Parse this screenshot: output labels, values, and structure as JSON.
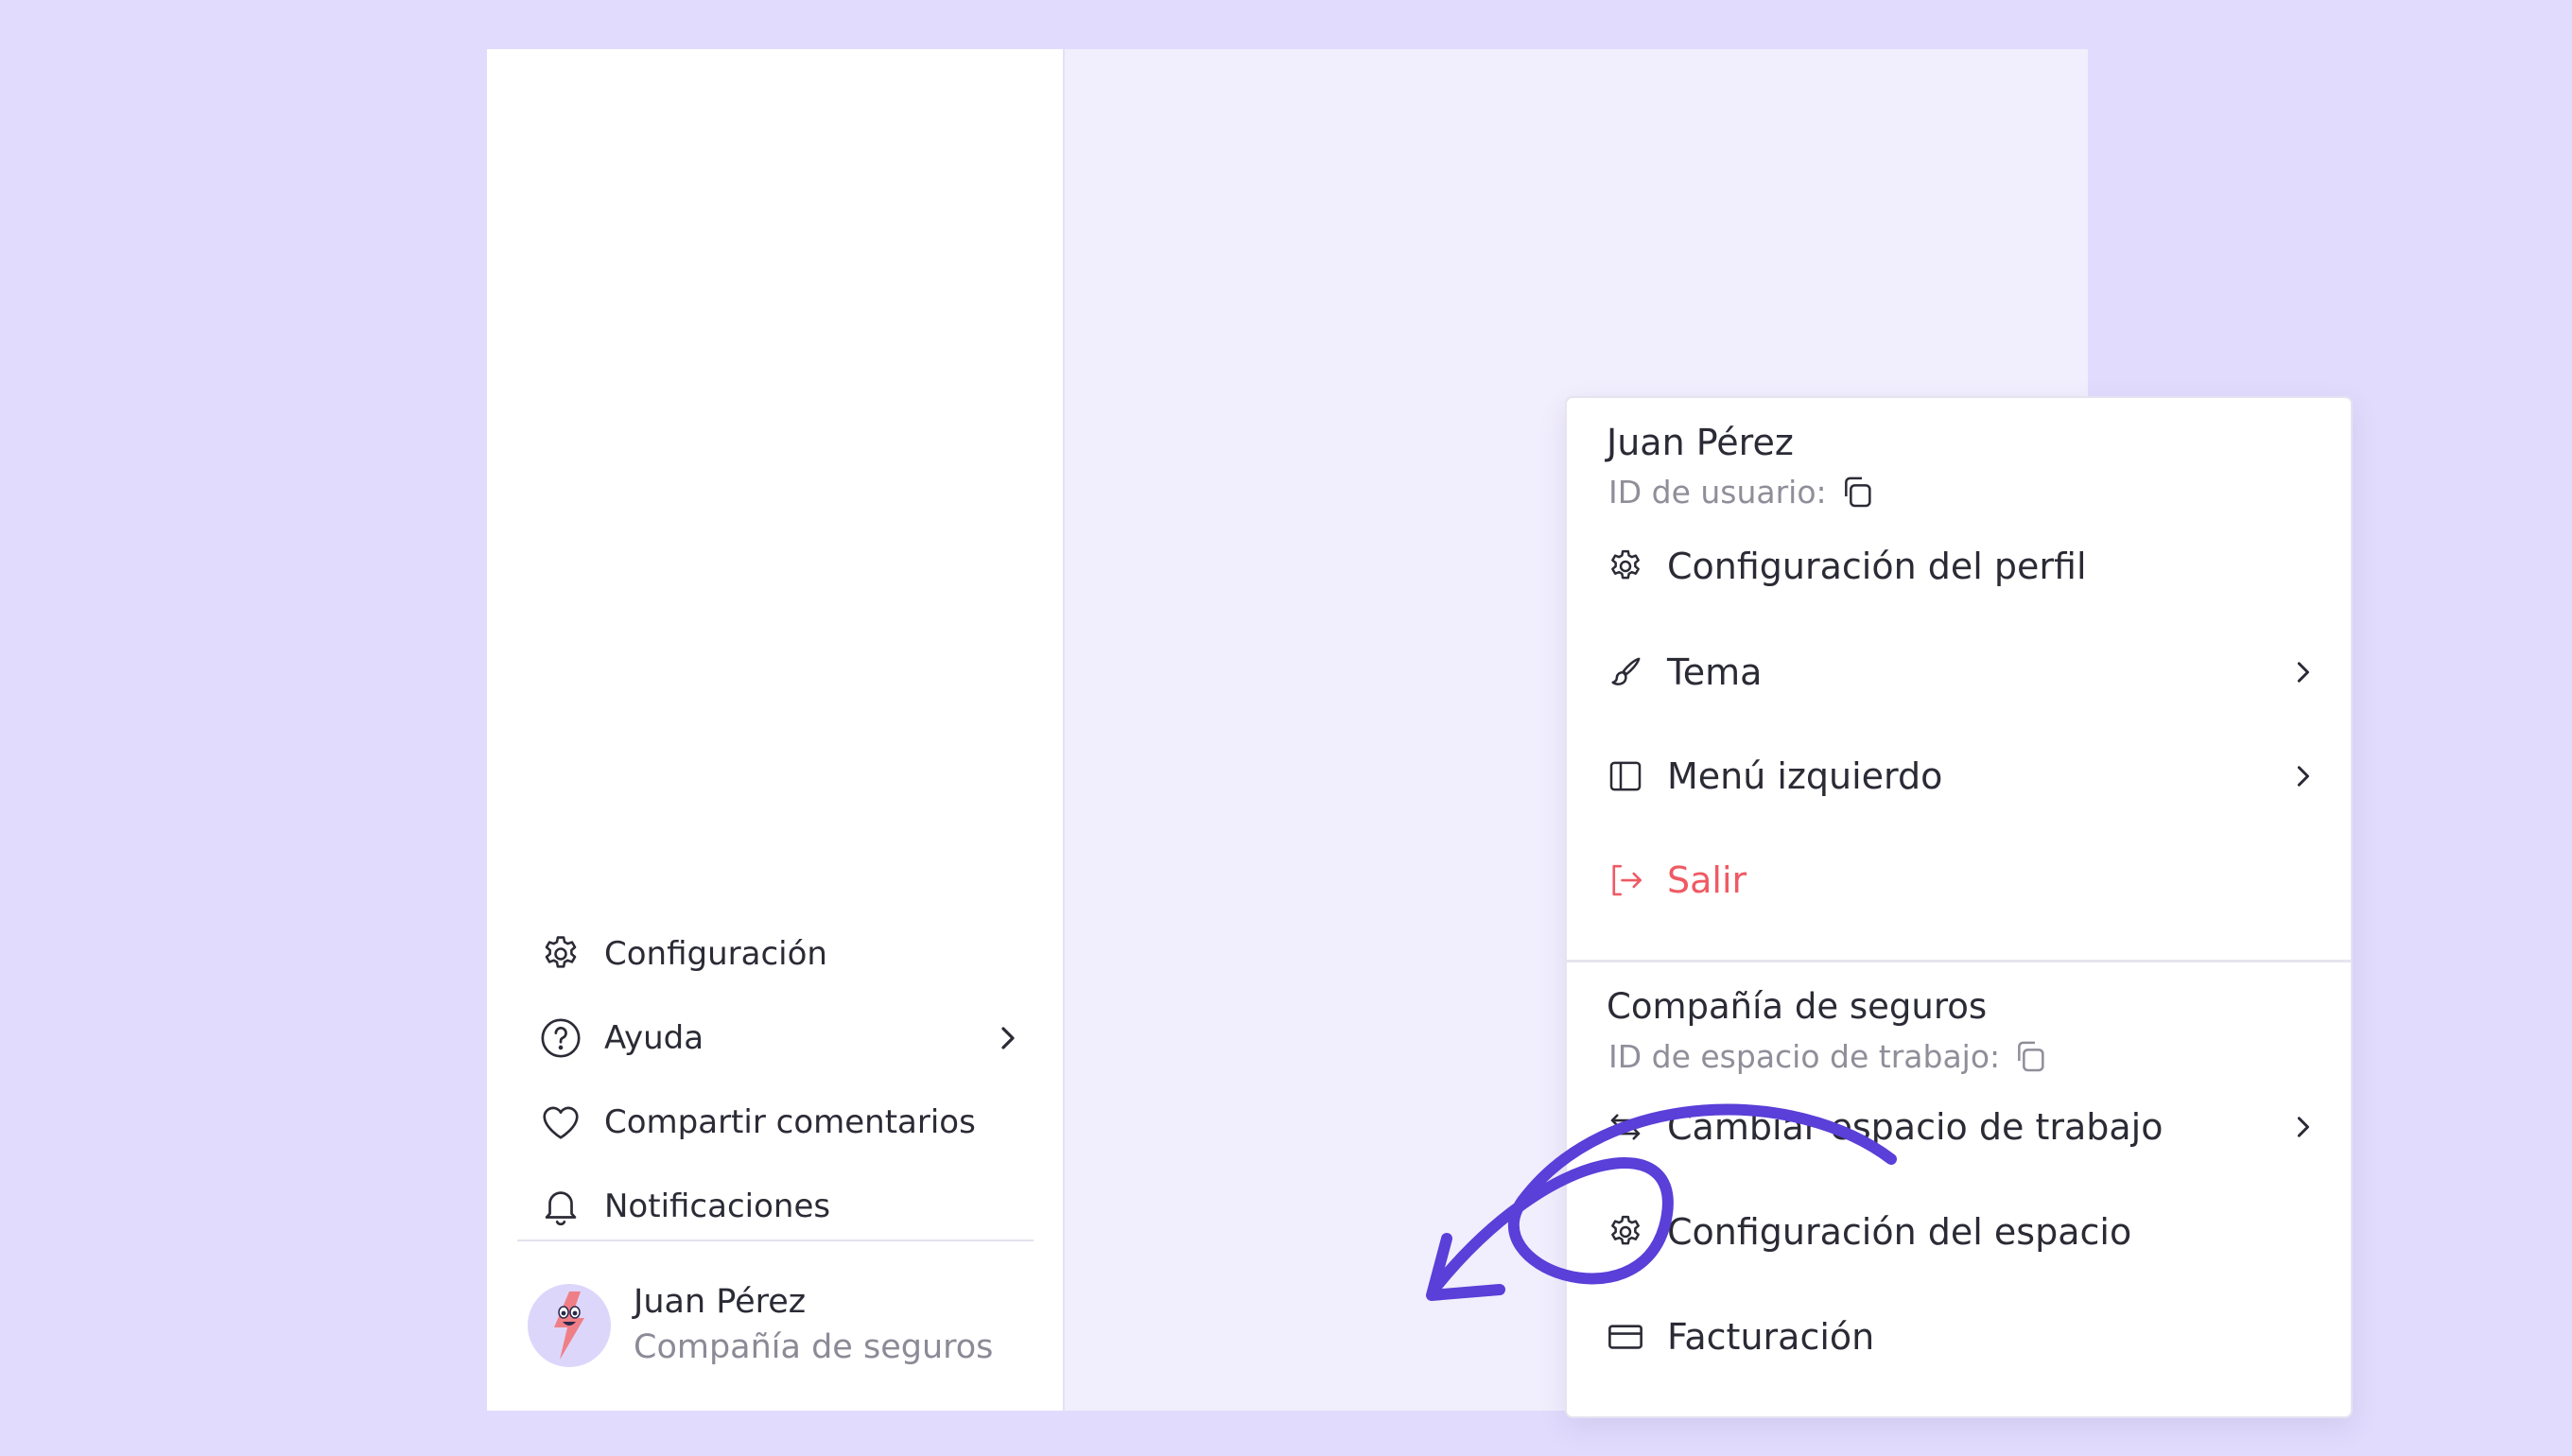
{
  "sidebar": {
    "items": [
      {
        "label": "Configuración",
        "icon": "gear-icon"
      },
      {
        "label": "Ayuda",
        "icon": "help-circle-icon",
        "has_submenu": true
      },
      {
        "label": "Compartir comentarios",
        "icon": "heart-icon"
      },
      {
        "label": "Notificaciones",
        "icon": "bell-icon"
      }
    ],
    "user": {
      "name": "Juan Pérez",
      "company": "Compañía de seguros"
    }
  },
  "menu": {
    "profile": {
      "name": "Juan Pérez",
      "id_label": "ID de usuario:"
    },
    "profile_items": [
      {
        "label": "Configuración del perfil",
        "icon": "gear-icon"
      },
      {
        "label": "Tema",
        "icon": "brush-icon",
        "has_submenu": true
      },
      {
        "label": "Menú izquierdo",
        "icon": "sidebar-layout-icon",
        "has_submenu": true
      },
      {
        "label": "Salir",
        "icon": "logout-icon",
        "color": "#ef5a64"
      }
    ],
    "workspace": {
      "name": "Compañía de seguros",
      "id_label": "ID de espacio de trabajo:"
    },
    "workspace_items": [
      {
        "label": "Cambiar espacio de trabajo",
        "icon": "switch-arrows-icon",
        "has_submenu": true
      },
      {
        "label": "Configuración del espacio",
        "icon": "gear-icon"
      },
      {
        "label": "Facturación",
        "icon": "credit-card-icon"
      }
    ]
  },
  "colors": {
    "page_background": "#e1dcfd",
    "app_background": "#f1eefd",
    "accent_arrow": "#5a3fd8",
    "danger": "#ef5a64"
  }
}
